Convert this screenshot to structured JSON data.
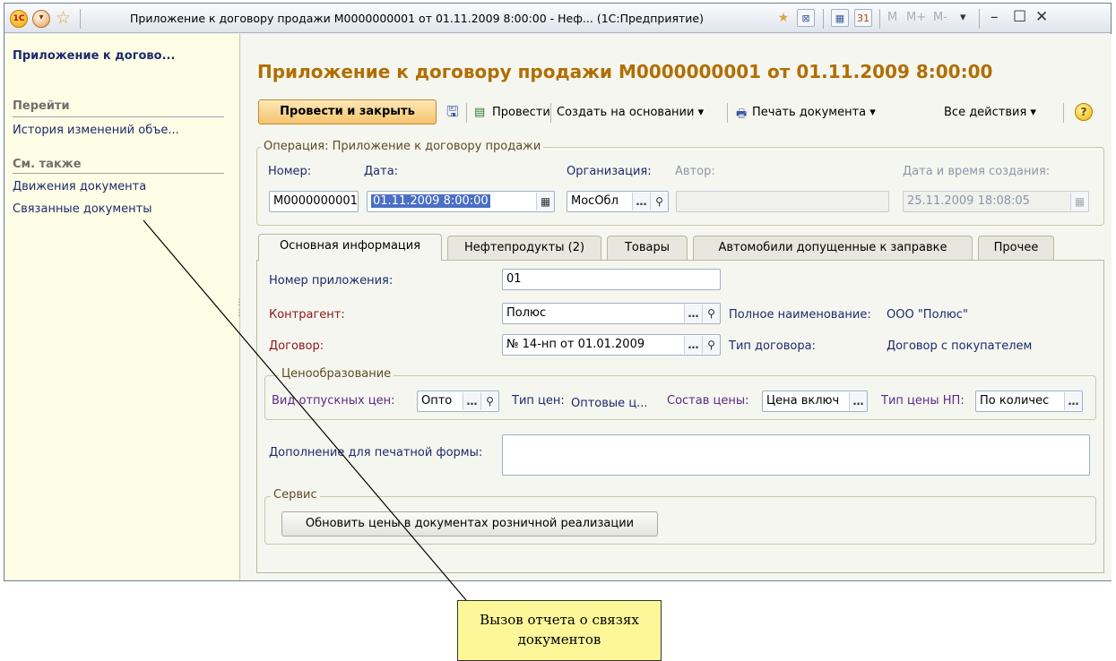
{
  "titlebar": {
    "title": "Приложение к договору продажи М0000000001 от 01.11.2009 8:00:00 - Неф... (1С:Предприятие)",
    "logo": "1С",
    "m_buttons": [
      "M",
      "M+",
      "M-"
    ]
  },
  "sidebar": {
    "title": "Приложение к догово...",
    "goto_header": "Перейти",
    "goto_items": [
      "История изменений объе..."
    ],
    "see_also_header": "См. также",
    "see_also_items": [
      "Движения документа",
      "Связанные документы"
    ]
  },
  "document": {
    "title": "Приложение к договору продажи М0000000001 от 01.11.2009 8:00:00"
  },
  "toolbar": {
    "post_and_close": "Провести и закрыть",
    "post": "Провести",
    "create_based": "Создать на основании ▾",
    "print": "Печать документа ▾",
    "all_actions": "Все действия ▾",
    "help": "?"
  },
  "operation": {
    "legend": "Операция: Приложение к договору продажи",
    "number_label": "Номер:",
    "number_value": "М0000000001",
    "date_label": "Дата:",
    "date_value": "01.11.2009  8:00:00",
    "org_label": "Организация:",
    "org_value": "МосОбл",
    "author_label": "Автор:",
    "author_value": "",
    "created_label": "Дата и время создания:",
    "created_value": "25.11.2009 18:08:05"
  },
  "tabs": [
    {
      "label": "Основная информация",
      "active": true
    },
    {
      "label": "Нефтепродукты (2)",
      "active": false
    },
    {
      "label": "Товары",
      "active": false
    },
    {
      "label": "Автомобили допущенные к заправке",
      "active": false
    },
    {
      "label": "Прочее",
      "active": false
    }
  ],
  "main_info": {
    "appendix_number_label": "Номер приложения:",
    "appendix_number_value": "01",
    "contractor_label": "Контрагент:",
    "contractor_value": "Полюс",
    "full_name_label": "Полное наименование:",
    "full_name_value": "ООО \"Полюс\"",
    "contract_label": "Договор:",
    "contract_value": "№ 14-нп от 01.01.2009",
    "contract_type_label": "Тип договора:",
    "contract_type_value": "Договор с покупателем"
  },
  "pricing": {
    "legend": "Ценообразование",
    "release_price_label": "Вид отпускных цен:",
    "release_price_value": "Опто",
    "price_type_label": "Тип цен:",
    "price_type_value": "Оптовые ц...",
    "price_composition_label": "Состав цены:",
    "price_composition_value": "Цена включ",
    "np_price_type_label": "Тип цены НП:",
    "np_price_type_value": "По количес"
  },
  "print_addition": {
    "label": "Дополнение для печатной формы:",
    "value": ""
  },
  "service": {
    "legend": "Сервис",
    "update_prices_button": "Обновить цены в документах розничной реализации"
  },
  "callout": {
    "text": "Вызов отчета о связях документов"
  },
  "colors": {
    "title_accent": "#b06e00",
    "sidebar_bg": "#fefee6",
    "link": "#1d2a6a",
    "primary_button": "#f5c46e",
    "callout_bg": "#fdf79a"
  }
}
